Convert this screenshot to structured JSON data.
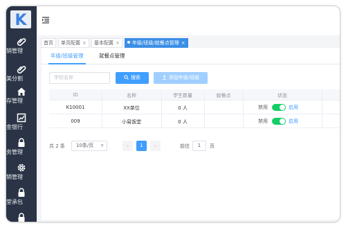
{
  "sidebar": {
    "logo_letter": "K",
    "items": [
      {
        "icon": "paperclip-icon",
        "label": "购销管理"
      },
      {
        "icon": "paperclip-icon",
        "label": "均美分割"
      },
      {
        "icon": "home-icon",
        "label": "库存管理"
      },
      {
        "icon": "chart-icon",
        "label": "现金银行"
      },
      {
        "icon": "lock-icon",
        "label": "财务管理"
      },
      {
        "icon": "gear-icon",
        "label": "营销管理"
      },
      {
        "icon": "lock-icon",
        "label": "食堂承包"
      }
    ]
  },
  "page_tabs": [
    {
      "label": "首页",
      "closable": false,
      "active": false
    },
    {
      "label": "单页配置",
      "closable": true,
      "active": false
    },
    {
      "label": "基本配置",
      "closable": true,
      "active": false
    },
    {
      "label": "年级/班级/就餐点管理",
      "closable": true,
      "active": true
    }
  ],
  "content_tabs": [
    {
      "label": "年级/班级管理",
      "active": true
    },
    {
      "label": "就餐点管理",
      "active": false
    }
  ],
  "toolbar": {
    "search_placeholder": "学校名称",
    "search_button": "搜索",
    "add_button": "添加年级/班级"
  },
  "table": {
    "columns": [
      "ID",
      "名称",
      "学生数量",
      "就餐点",
      "状态"
    ],
    "rows": [
      {
        "id": "K10001",
        "name": "XX单位",
        "students": "0 人",
        "dining": "",
        "status_off": "禁用",
        "status_on": "启用",
        "enabled": true
      },
      {
        "id": "009",
        "name": "小易饭堂",
        "students": "0 人",
        "dining": "",
        "status_off": "禁用",
        "status_on": "启用",
        "enabled": true
      }
    ]
  },
  "pagination": {
    "total_text": "共 2 条",
    "page_size": "10条/页",
    "current_page": "1",
    "goto_label": "前往",
    "goto_value": "1",
    "page_unit": "页"
  },
  "colors": {
    "primary": "#409eff",
    "sidebar_bg": "#2a3446",
    "switch_on": "#13ce66"
  }
}
